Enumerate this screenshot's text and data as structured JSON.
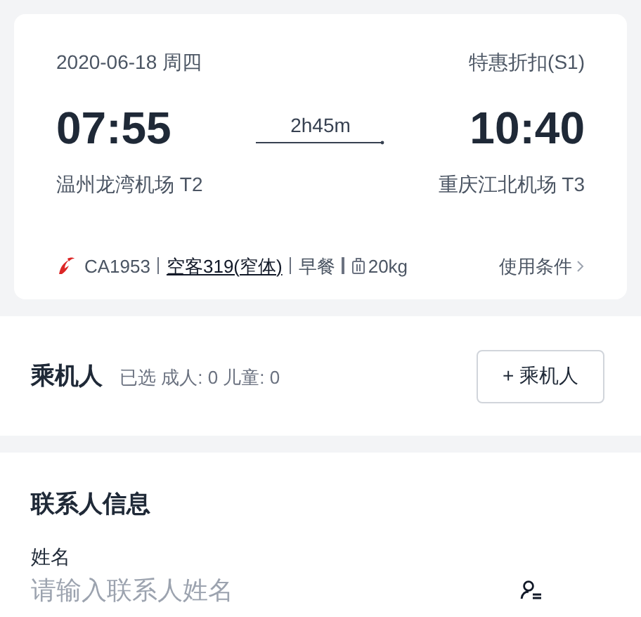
{
  "flight": {
    "date": "2020-06-18 周四",
    "fare_class": "特惠折扣(S1)",
    "departure": {
      "time": "07:55",
      "airport": "温州龙湾机场 T2"
    },
    "duration": "2h45m",
    "arrival": {
      "time": "10:40",
      "airport": "重庆江北机场 T3"
    },
    "details": [
      {
        "kind": "flight_no",
        "text": "CA1953"
      },
      {
        "kind": "aircraft",
        "text": "空客319(窄体)"
      },
      {
        "kind": "meal",
        "text": "早餐"
      },
      {
        "kind": "baggage",
        "text": "20kg"
      }
    ],
    "conditions_link": "使用条件"
  },
  "passengers": {
    "title": "乘机人",
    "summary": "已选 成人: 0 儿童: 0",
    "add_button": "+ 乘机人"
  },
  "contact": {
    "title": "联系人信息",
    "fields": [
      {
        "label": "姓名",
        "placeholder": "请输入联系人姓名"
      }
    ]
  }
}
